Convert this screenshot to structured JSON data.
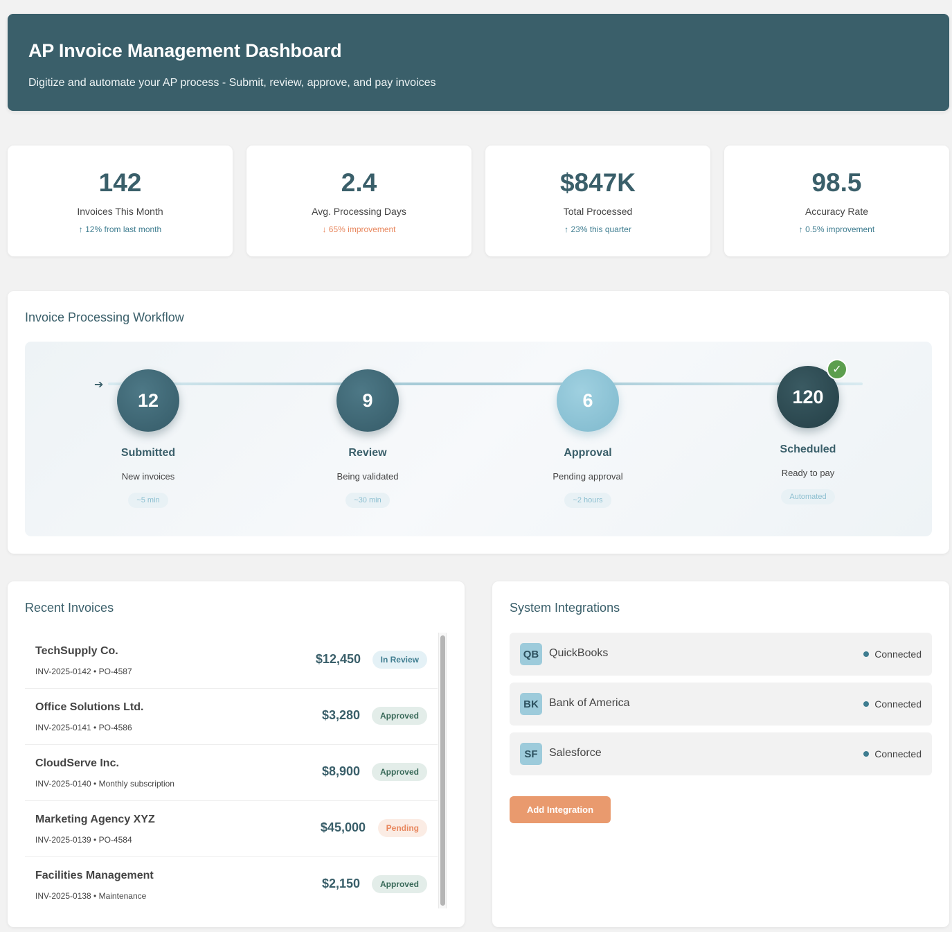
{
  "header": {
    "title": "AP Invoice Management Dashboard",
    "subtitle": "Digitize and automate your AP process - Submit, review, approve, and pay invoices"
  },
  "stats": [
    {
      "value": "142",
      "label": "Invoices This Month",
      "trend": "↑ 12% from last month",
      "direction": "up"
    },
    {
      "value": "2.4",
      "label": "Avg. Processing Days",
      "trend": "↓ 65% improvement",
      "direction": "down"
    },
    {
      "value": "$847K",
      "label": "Total Processed",
      "trend": "↑ 23% this quarter",
      "direction": "up"
    },
    {
      "value": "98.5",
      "label": "Accuracy Rate",
      "trend": "↑ 0.5% improvement",
      "direction": "up"
    }
  ],
  "workflow": {
    "title": "Invoice Processing Workflow",
    "arrow_icon": "arrow-right-icon",
    "steps": [
      {
        "count": "12",
        "name": "Submitted",
        "desc": "New invoices",
        "time": "~5 min"
      },
      {
        "count": "9",
        "name": "Review",
        "desc": "Being validated",
        "time": "~30 min"
      },
      {
        "count": "6",
        "name": "Approval",
        "desc": "Pending approval",
        "time": "~2 hours"
      },
      {
        "count": "120",
        "name": "Scheduled",
        "desc": "Ready to pay",
        "time": "Automated",
        "check": "✓"
      }
    ]
  },
  "recent_invoices": {
    "title": "Recent Invoices",
    "items": [
      {
        "vendor": "TechSupply Co.",
        "meta": "INV-2025-0142 • PO-4587",
        "amount": "$12,450",
        "status": "In Review",
        "status_type": "review"
      },
      {
        "vendor": "Office Solutions Ltd.",
        "meta": "INV-2025-0141 • PO-4586",
        "amount": "$3,280",
        "status": "Approved",
        "status_type": "approved"
      },
      {
        "vendor": "CloudServe Inc.",
        "meta": "INV-2025-0140 • Monthly subscription",
        "amount": "$8,900",
        "status": "Approved",
        "status_type": "approved"
      },
      {
        "vendor": "Marketing Agency XYZ",
        "meta": "INV-2025-0139 • PO-4584",
        "amount": "$45,000",
        "status": "Pending",
        "status_type": "pending"
      },
      {
        "vendor": "Facilities Management",
        "meta": "INV-2025-0138 • Maintenance",
        "amount": "$2,150",
        "status": "Approved",
        "status_type": "approved"
      }
    ]
  },
  "integrations": {
    "title": "System Integrations",
    "items": [
      {
        "abbr": "QB",
        "name": "QuickBooks",
        "status": "Connected"
      },
      {
        "abbr": "BK",
        "name": "Bank of America",
        "status": "Connected"
      },
      {
        "abbr": "SF",
        "name": "Salesforce",
        "status": "Connected"
      }
    ],
    "add_button": "Add Integration"
  },
  "colors": {
    "primary": "#3a5f6a",
    "accent": "#e99a6e",
    "light_blue": "#9dcbdb",
    "success": "#5c9e4e"
  }
}
